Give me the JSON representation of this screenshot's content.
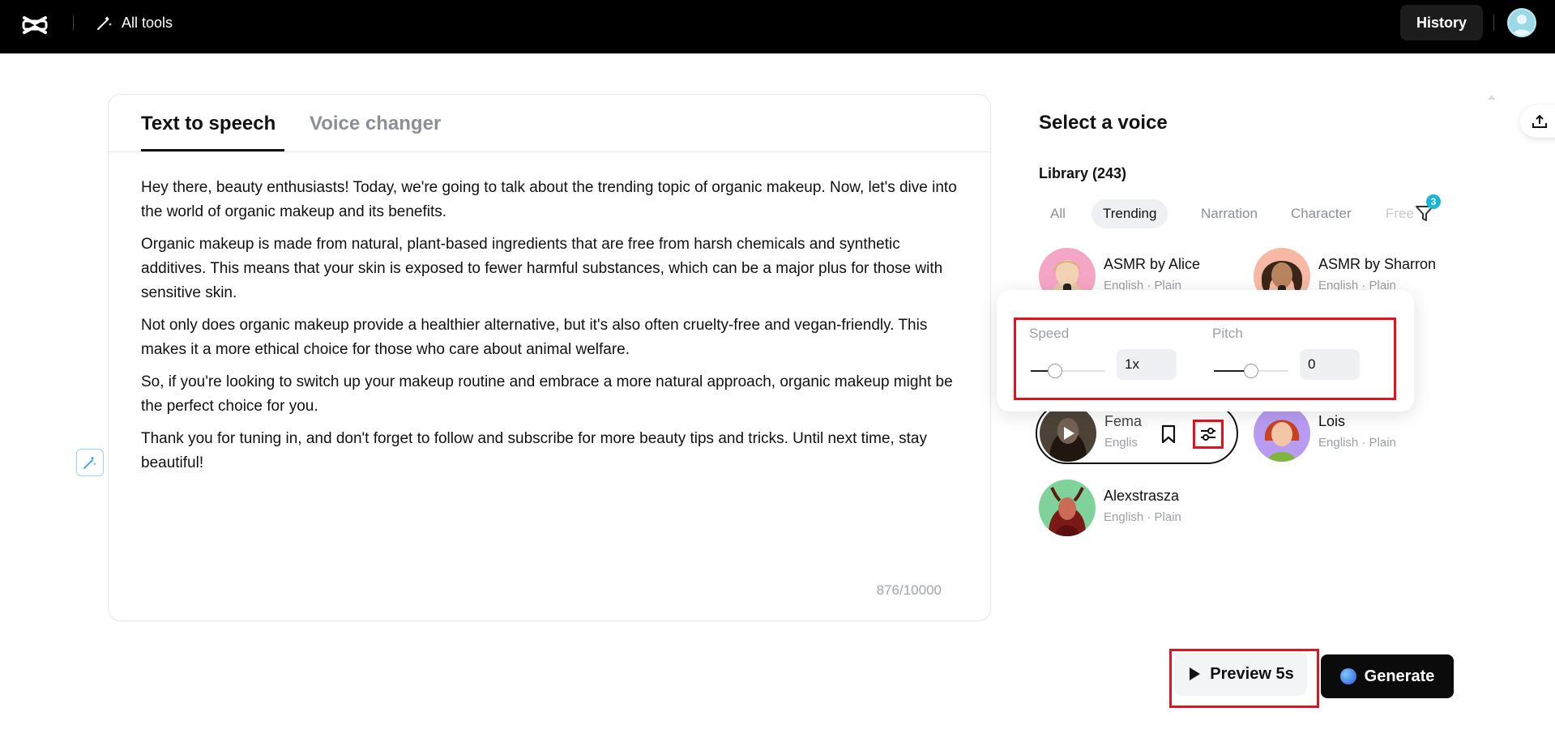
{
  "topbar": {
    "all_tools_label": "All tools",
    "history_label": "History"
  },
  "editor": {
    "tabs": [
      {
        "label": "Text to speech",
        "active": true
      },
      {
        "label": "Voice changer",
        "active": false
      }
    ],
    "paragraphs": [
      "Hey there, beauty enthusiasts! Today, we're going to talk about the trending topic of organic makeup. Now, let's dive into the world of organic makeup and its benefits.",
      "Organic makeup is made from natural, plant-based ingredients that are free from harsh chemicals and synthetic additives. This means that your skin is exposed to fewer harmful substances, which can be a major plus for those with sensitive skin.",
      "Not only does organic makeup provide a healthier alternative, but it's also often cruelty-free and vegan-friendly. This makes it a more ethical choice for those who care about animal welfare.",
      "So, if you're looking to switch up your makeup routine and embrace a more natural approach, organic makeup might be the perfect choice for you.",
      "Thank you for tuning in, and don't forget to follow and subscribe for more beauty tips and tricks. Until next time, stay beautiful!"
    ],
    "char_count": "876/10000"
  },
  "voice_panel": {
    "title": "Select a voice",
    "library_label": "Library (243)",
    "filters": [
      "All",
      "Trending",
      "Narration",
      "Character",
      "Free"
    ],
    "active_filter": "Trending",
    "filter_badge": "3",
    "voices": [
      {
        "name": "ASMR by Alice",
        "meta": "English · Plain"
      },
      {
        "name": "ASMR by Sharron",
        "meta": "English · Plain"
      },
      {
        "name": "Fema",
        "meta": "Englis"
      },
      {
        "name": "Lois",
        "meta": "English · Plain"
      },
      {
        "name": "Alexstrasza",
        "meta": "English · Plain"
      }
    ]
  },
  "popover": {
    "speed_label": "Speed",
    "speed_value": "1x",
    "speed_fraction": 0.33,
    "pitch_label": "Pitch",
    "pitch_value": "0",
    "pitch_fraction": 0.5
  },
  "actions": {
    "preview_label": "Preview 5s",
    "generate_label": "Generate"
  },
  "colors": {
    "highlight": "#e3121f",
    "badge": "#18b6d8"
  }
}
